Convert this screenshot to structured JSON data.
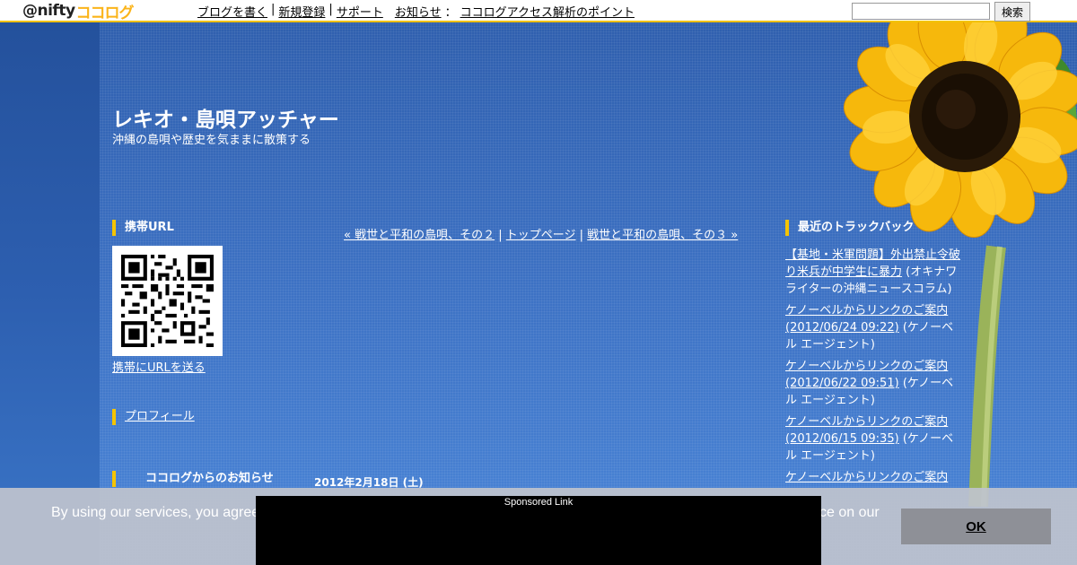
{
  "header": {
    "logo_prefix": "@nifty",
    "logo_brand": "ココログ",
    "nav": [
      {
        "label": "ブログを書く"
      },
      {
        "label": "新規登録"
      },
      {
        "label": "サポート"
      },
      {
        "label": "お知らせ"
      },
      {
        "label": "ココログアクセス解析のポイント"
      }
    ],
    "search_value": "",
    "search_button": "検索"
  },
  "blog": {
    "title": "レキオ・島唄アッチャー",
    "description": "沖縄の島唄や歴史を気ままに散策する"
  },
  "left_sidebar": {
    "mobile_heading": "携帯URL",
    "send_url_link": "携帯にURLを送る",
    "profile_link": "プロフィール",
    "notice_heading": "ココログからのお知らせ"
  },
  "post_nav": {
    "prev": "« 戦世と平和の島唄、その２",
    "top": "トップページ",
    "next": "戦世と平和の島唄、その３ »"
  },
  "post": {
    "date": "2012年2月18日 (土)"
  },
  "right_sidebar": {
    "heading": "最近のトラックバック",
    "trackbacks": [
      {
        "link": "【基地・米軍問題】外出禁止令破り米兵が中学生に暴力",
        "source": "(オキナワライターの沖縄ニュースコラム)"
      },
      {
        "link": "ケノーベルからリンクのご案内(2012/06/24 09:22)",
        "source": "(ケノーベル エージェント)"
      },
      {
        "link": "ケノーベルからリンクのご案内(2012/06/22 09:51)",
        "source": "(ケノーベル エージェント)"
      },
      {
        "link": "ケノーベルからリンクのご案内(2012/06/15 09:35)",
        "source": "(ケノーベル エージェント)"
      },
      {
        "link": "ケノーベルからリンクのご案内",
        "source": ""
      }
    ]
  },
  "cookie": {
    "text_left": "By using our services, you agree",
    "text_right": "ce on our",
    "ok_label": "OK"
  },
  "ad": {
    "label": "Sponsored Link"
  },
  "colors": {
    "accent": "#f5c400",
    "background": "#3a6cbc",
    "ok_button": "#8e9097"
  }
}
